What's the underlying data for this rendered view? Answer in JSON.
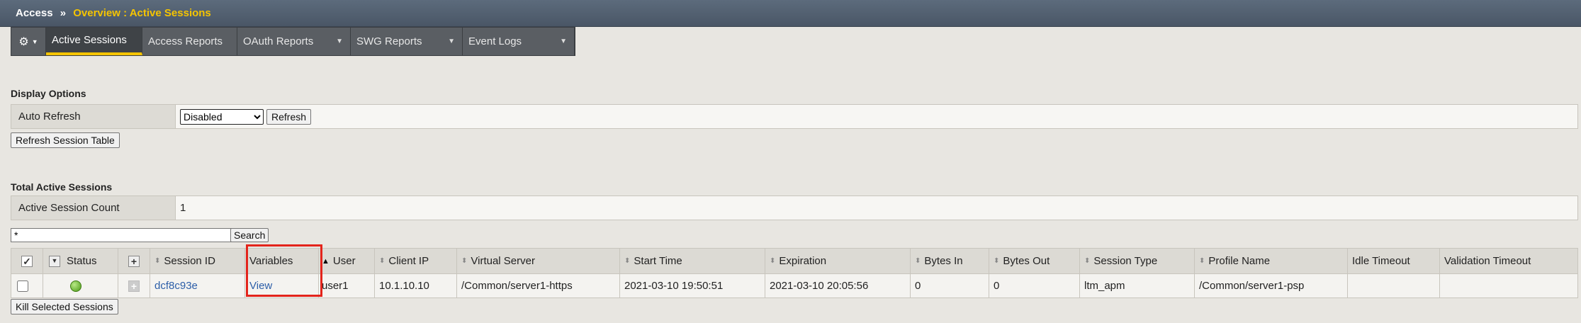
{
  "breadcrumb": {
    "root": "Access",
    "separator": "»",
    "page": "Overview : Active Sessions"
  },
  "menu": {
    "tabs": [
      {
        "label": "Active Sessions",
        "active": true,
        "dropdown": false
      },
      {
        "label": "Access Reports",
        "active": false,
        "dropdown": false
      },
      {
        "label": "OAuth Reports",
        "active": false,
        "dropdown": true
      },
      {
        "label": "SWG Reports",
        "active": false,
        "dropdown": true
      },
      {
        "label": "Event Logs",
        "active": false,
        "dropdown": true
      }
    ]
  },
  "display_options": {
    "title": "Display Options",
    "auto_refresh_label": "Auto Refresh",
    "auto_refresh_value": "Disabled",
    "refresh_button": "Refresh",
    "refresh_table_button": "Refresh Session Table"
  },
  "totals": {
    "title": "Total Active Sessions",
    "count_label": "Active Session Count",
    "count_value": "1"
  },
  "search": {
    "value": "*",
    "button": "Search"
  },
  "table": {
    "headers": {
      "status": "Status",
      "session_id": "Session ID",
      "variables": "Variables",
      "user": "User",
      "client_ip": "Client IP",
      "virtual_server": "Virtual Server",
      "start_time": "Start Time",
      "expiration": "Expiration",
      "bytes_in": "Bytes In",
      "bytes_out": "Bytes Out",
      "session_type": "Session Type",
      "profile_name": "Profile Name",
      "idle_timeout": "Idle Timeout",
      "validation_timeout": "Validation Timeout"
    },
    "rows": [
      {
        "session_id": "dcf8c93e",
        "variables": "View",
        "user": "user1",
        "client_ip": "10.1.10.10",
        "virtual_server": "/Common/server1-https",
        "start_time": "2021-03-10 19:50:51",
        "expiration": "2021-03-10 20:05:56",
        "bytes_in": "0",
        "bytes_out": "0",
        "session_type": "ltm_apm",
        "profile_name": "/Common/server1-psp",
        "idle_timeout": "",
        "validation_timeout": ""
      }
    ]
  },
  "kill_button": "Kill Selected Sessions",
  "colors": {
    "accent": "#f5c400",
    "highlight": "#e3241b",
    "link": "#2c5ea8"
  }
}
